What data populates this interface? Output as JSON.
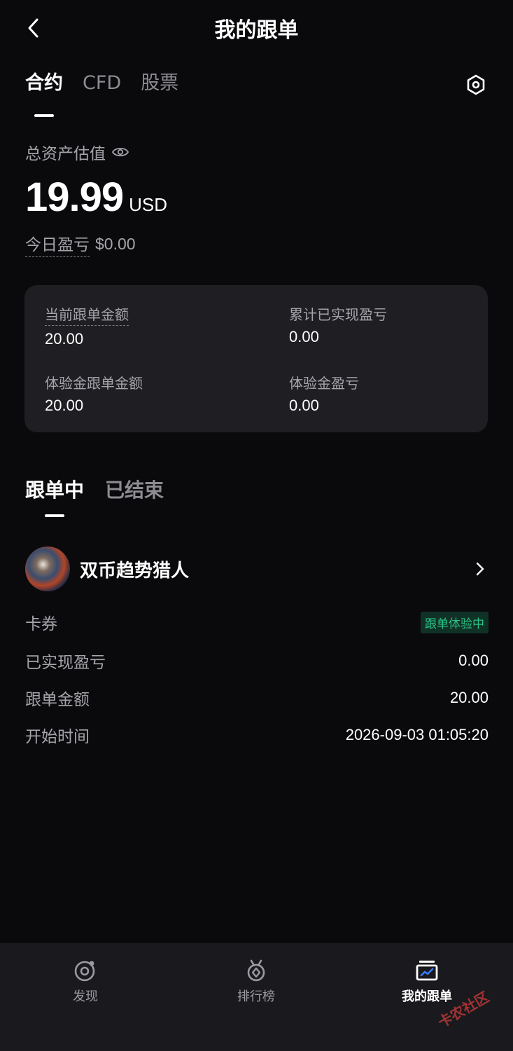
{
  "header": {
    "title": "我的跟单",
    "back_icon": "chevron-left-icon"
  },
  "top_tabs": [
    {
      "label": "合约",
      "active": true
    },
    {
      "label": "CFD",
      "active": false
    },
    {
      "label": "股票",
      "active": false
    }
  ],
  "settings_icon": "hexagon-settings-icon",
  "assets": {
    "label": "总资产估值",
    "eye_icon": "eye-icon",
    "value": "19.99",
    "unit": "USD",
    "today_pnl_label": "今日盈亏",
    "today_pnl_value": "$0.00"
  },
  "summary": {
    "current_amount_label": "当前跟单金额",
    "current_amount_value": "20.00",
    "realized_pnl_label": "累计已实现盈亏",
    "realized_pnl_value": "0.00",
    "trial_amount_label": "体验金跟单金额",
    "trial_amount_value": "20.00",
    "trial_pnl_label": "体验金盈亏",
    "trial_pnl_value": "0.00"
  },
  "section_tabs": [
    {
      "label": "跟单中",
      "active": true
    },
    {
      "label": "已结束",
      "active": false
    }
  ],
  "trader": {
    "name": "双币趋势猎人",
    "rows": [
      {
        "label": "卡券",
        "value": "跟单体验中",
        "badge": true
      },
      {
        "label": "已实现盈亏",
        "value": "0.00"
      },
      {
        "label": "跟单金额",
        "value": "20.00"
      },
      {
        "label": "开始时间",
        "value": "2026-09-03 01:05:20"
      }
    ]
  },
  "bottom_nav": [
    {
      "label": "发现",
      "icon": "discover-icon",
      "active": false
    },
    {
      "label": "排行榜",
      "icon": "medal-icon",
      "active": false
    },
    {
      "label": "我的跟单",
      "icon": "portfolio-chart-icon",
      "active": true
    }
  ],
  "watermark": "卡农社区",
  "colors": {
    "background": "#0a0a0c",
    "card": "#1f1f23",
    "muted_text": "#a4a4aa",
    "badge_green": "#2bc287",
    "nav_bg": "#1a1a1e"
  }
}
